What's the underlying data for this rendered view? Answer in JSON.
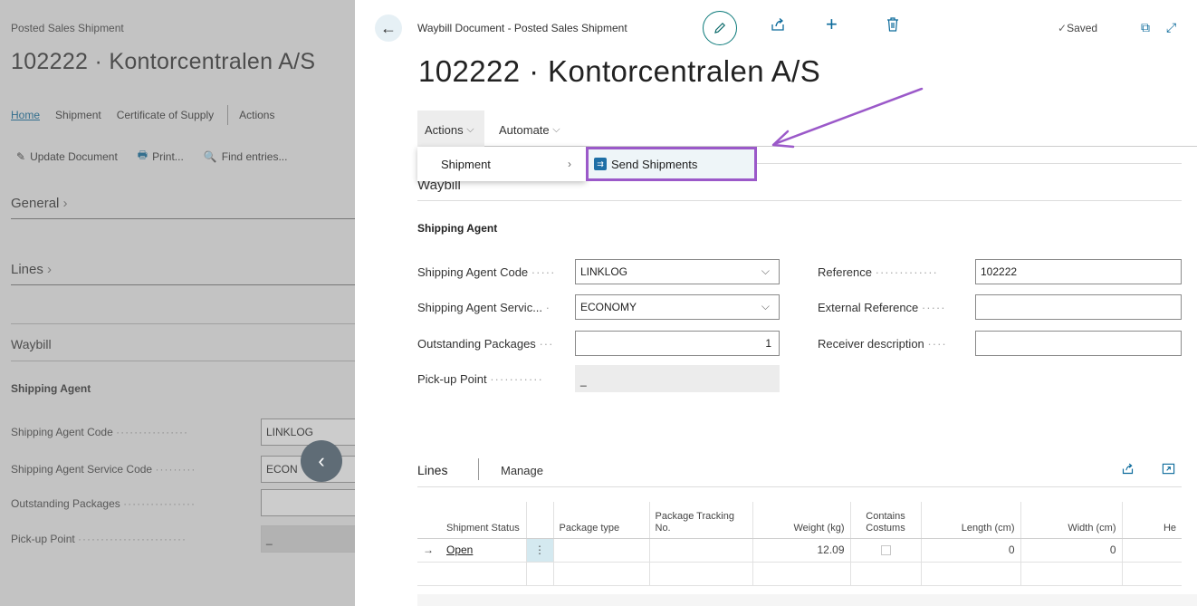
{
  "background_page": {
    "caption": "Posted Sales Shipment",
    "title": "102222 · Kontorcentralen A/S",
    "tabs": [
      "Home",
      "Shipment",
      "Certificate of Supply",
      "Actions"
    ],
    "actions": [
      {
        "label": "Update Document",
        "icon": "pencil-icon"
      },
      {
        "label": "Print...",
        "icon": "printer-icon"
      },
      {
        "label": "Find entries...",
        "icon": "find-entries-icon"
      }
    ],
    "sections": {
      "general": "General",
      "lines": "Lines",
      "waybill": "Waybill"
    },
    "shipping_agent_header": "Shipping Agent",
    "fields": [
      {
        "label": "Shipping Agent Code",
        "value": "LINKLOG"
      },
      {
        "label": "Shipping Agent Service Code",
        "value": "ECON"
      },
      {
        "label": "Outstanding Packages",
        "value": ""
      },
      {
        "label": "Pick-up Point",
        "value": "_"
      }
    ]
  },
  "card": {
    "caption": "Waybill Document - Posted Sales Shipment",
    "status": "Saved",
    "title": "102222 · Kontorcentralen A/S",
    "menu": {
      "actions": "Actions",
      "automate": "Automate"
    },
    "dropdown": {
      "item": "Shipment",
      "submenu_item": "Send Shipments"
    },
    "section_waybill": "Waybill",
    "shipping_agent_header": "Shipping Agent",
    "fields_left": [
      {
        "label": "Shipping Agent Code",
        "value": "LINKLOG",
        "type": "select"
      },
      {
        "label": "Shipping Agent Servic...",
        "value": "ECONOMY",
        "type": "select"
      },
      {
        "label": "Outstanding Packages",
        "value": "1",
        "type": "number"
      },
      {
        "label": "Pick-up Point",
        "value": "_",
        "type": "readonly"
      }
    ],
    "fields_right": [
      {
        "label": "Reference",
        "value": "102222"
      },
      {
        "label": "External Reference",
        "value": ""
      },
      {
        "label": "Receiver description",
        "value": ""
      }
    ],
    "lines": {
      "title": "Lines",
      "manage": "Manage",
      "columns": [
        "Shipment Status",
        "Package type",
        "Package Tracking No.",
        "Weight (kg)",
        "Contains Costums",
        "Length (cm)",
        "Width (cm)",
        "He"
      ],
      "rows": [
        {
          "status": "Open",
          "package_type": "",
          "tracking_no": "",
          "weight": "12.09",
          "contains_costums": false,
          "length": "0",
          "width": "0"
        }
      ]
    }
  },
  "colors": {
    "accent": "#0b6a9b",
    "highlight_border": "#9b59c9",
    "annotation_arrow": "#9b59c9"
  }
}
